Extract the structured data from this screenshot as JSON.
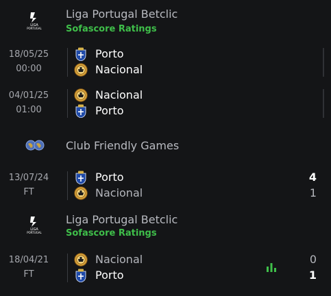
{
  "sections": [
    {
      "league": "Liga Portugal Betclic",
      "sub": "Sofascore Ratings",
      "logo_text": [
        "LIGA",
        "PORTUGAL"
      ]
    },
    {
      "league": "Club Friendly Games"
    },
    {
      "league": "Liga Portugal Betclic",
      "sub": "Sofascore Ratings",
      "logo_text": [
        "LIGA",
        "PORTUGAL"
      ]
    }
  ],
  "matches": [
    {
      "date": "18/05/25",
      "time": "00:00",
      "home": "Porto",
      "away": "Nacional"
    },
    {
      "date": "04/01/25",
      "time": "01:00",
      "home": "Nacional",
      "away": "Porto"
    },
    {
      "date": "13/07/24",
      "time": "FT",
      "home": "Porto",
      "away": "Nacional",
      "home_score": "4",
      "away_score": "1"
    },
    {
      "date": "18/04/21",
      "time": "FT",
      "home": "Nacional",
      "away": "Porto",
      "home_score": "0",
      "away_score": "1"
    }
  ],
  "colors": {
    "accent_green": "#3fbf4a",
    "background": "#141517",
    "porto_blue": "#1f4aa8",
    "nacional_gold": "#d7a23a"
  },
  "icons": [
    "liga-portugal-logo",
    "club-friendly-globe-icon",
    "porto-crest-icon",
    "nacional-crest-icon",
    "stats-bar-icon"
  ]
}
